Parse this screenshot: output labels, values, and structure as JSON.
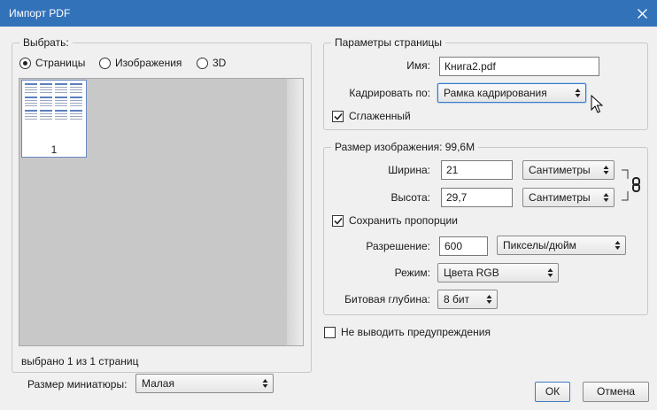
{
  "window": {
    "title": "Импорт PDF"
  },
  "select_group": {
    "legend": "Выбрать:",
    "radios": [
      {
        "label": "Страницы",
        "selected": true
      },
      {
        "label": "Изображения",
        "selected": false
      },
      {
        "label": "3D",
        "selected": false
      }
    ],
    "thumbnail": {
      "page_number": "1"
    },
    "status": "выбрано 1 из 1 страниц",
    "thumb_size_label": "Размер миниатюры:",
    "thumb_size_value": "Малая"
  },
  "page_params": {
    "legend": "Параметры страницы",
    "name_label": "Имя:",
    "name_value": "Книга2.pdf",
    "crop_label": "Кадрировать по:",
    "crop_value": "Рамка кадрирования",
    "antialias_label": "Сглаженный",
    "antialias_checked": true
  },
  "image_size": {
    "legend": "Размер изображения: 99,6M",
    "width_label": "Ширина:",
    "width_value": "21",
    "width_unit": "Сантиметры",
    "height_label": "Высота:",
    "height_value": "29,7",
    "height_unit": "Сантиметры",
    "constrain_label": "Сохранить пропорции",
    "constrain_checked": true,
    "resolution_label": "Разрешение:",
    "resolution_value": "600",
    "resolution_unit": "Пикселы/дюйм",
    "mode_label": "Режим:",
    "mode_value": "Цвета RGB",
    "depth_label": "Битовая глубина:",
    "depth_value": "8 бит"
  },
  "suppress_warnings": {
    "label": "Не выводить предупреждения",
    "checked": false
  },
  "buttons": {
    "ok": "ОК",
    "cancel": "Отмена"
  },
  "colors": {
    "titlebar": "#3272b9",
    "focus": "#3d7bc4"
  }
}
